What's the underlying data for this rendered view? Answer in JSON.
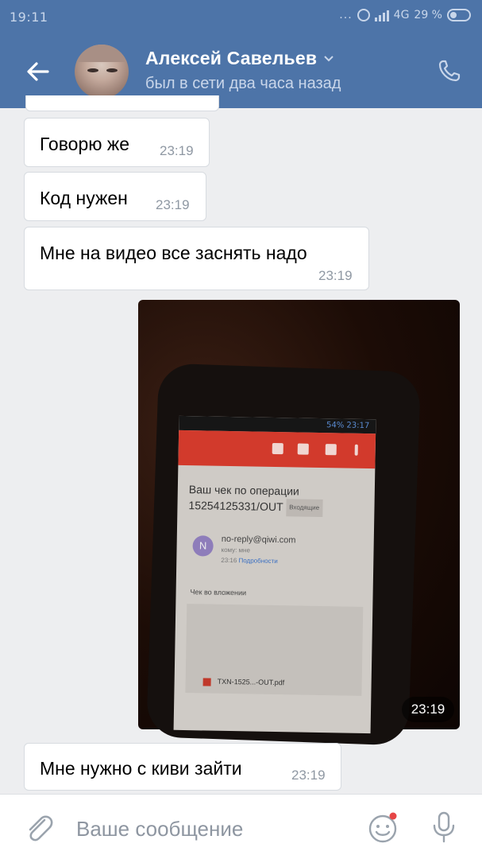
{
  "statusbar": {
    "time": "19:11",
    "dots": "...",
    "network": "4G",
    "battery": "29 %"
  },
  "header": {
    "name": "Алексей Савельев",
    "status": "был в сети два часа назад"
  },
  "messages": [
    {
      "text": "Говорю же",
      "time": "23:19"
    },
    {
      "text": "Код нужен",
      "time": "23:19"
    },
    {
      "text": "Мне на видео все заснять надо",
      "time": "23:19"
    },
    {
      "type": "photo",
      "time": "23:19"
    },
    {
      "text": "Мне нужно с киви зайти",
      "time": "23:19"
    }
  ],
  "photo_content": {
    "status": "54% 23:17",
    "subject_line1": "Ваш чек по операции",
    "subject_line2": "15254125331/OUT",
    "badge": "Входящие",
    "avatar_letter": "N",
    "from": "no-reply@qiwi.com",
    "to": "кому: мне",
    "time_prefix": "23:16",
    "details": "Подробности",
    "body": "Чек во вложении",
    "file": "TXN-1525...-OUT.pdf"
  },
  "input": {
    "placeholder": "Ваше сообщение"
  },
  "colors": {
    "header_bg": "#4d74a8",
    "chat_bg": "#edeef0",
    "bubble_bg": "#ffffff",
    "time_text": "#8f98a3"
  }
}
